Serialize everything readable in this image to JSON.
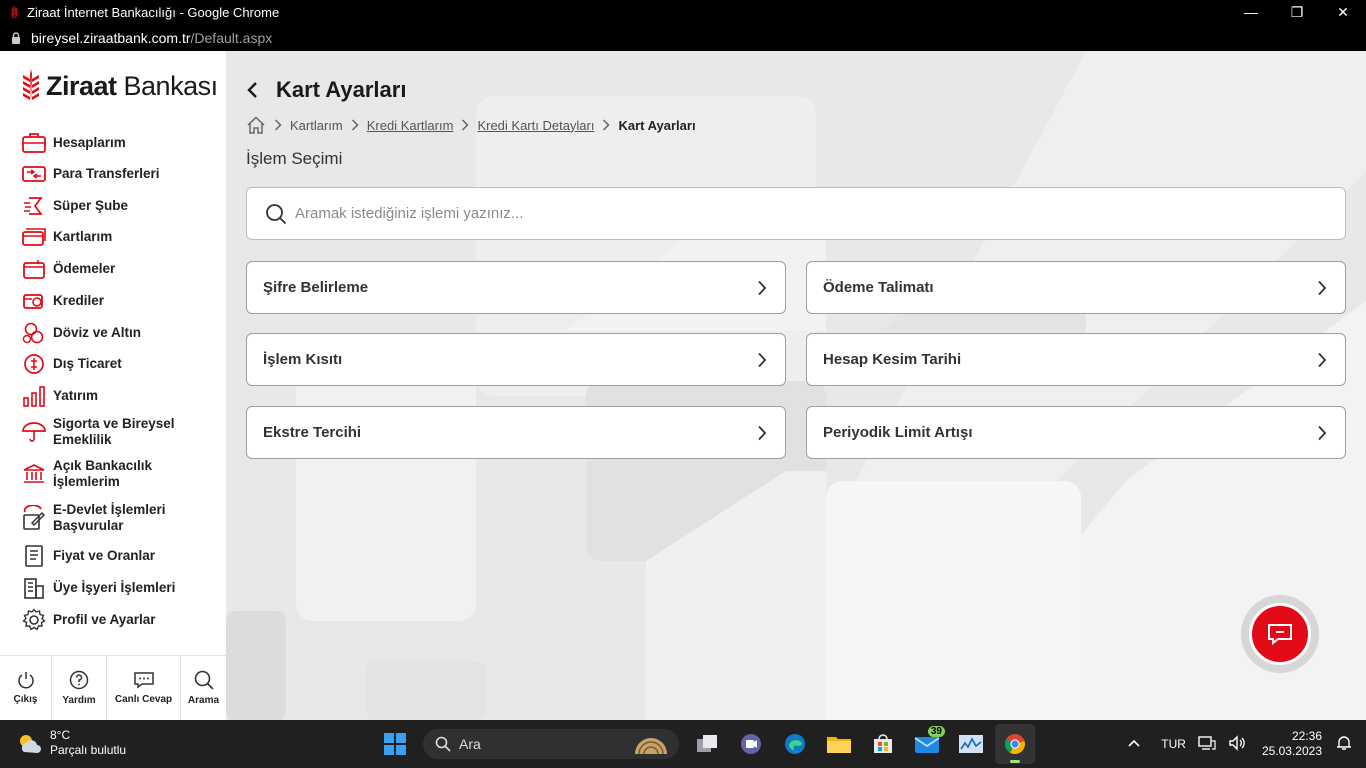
{
  "browser": {
    "window_title": "Ziraat İnternet Bankacılığı - Google Chrome",
    "url_host": "bireysel.ziraatbank.com.tr",
    "url_path": "/Default.aspx"
  },
  "brand": {
    "name_bold": "Ziraat",
    "name_light": " Bankası",
    "accent": "#e30a17"
  },
  "sidebar": {
    "items": [
      {
        "label": "Hesaplarım",
        "icon": "briefcase-icon"
      },
      {
        "label": "Para Transferleri",
        "icon": "transfer-icon"
      },
      {
        "label": "Süper Şube",
        "icon": "super-branch-icon"
      },
      {
        "label": "Kartlarım",
        "icon": "card-icon"
      },
      {
        "label": "Ödemeler",
        "icon": "payment-icon"
      },
      {
        "label": "Krediler",
        "icon": "credit-icon"
      },
      {
        "label": "Döviz ve Altın",
        "icon": "currency-icon"
      },
      {
        "label": "Dış Ticaret",
        "icon": "foreign-trade-icon"
      },
      {
        "label": "Yatırım",
        "icon": "investment-icon"
      },
      {
        "label": "Sigorta ve Bireysel Emeklilik",
        "icon": "umbrella-icon"
      },
      {
        "label": "Açık Bankacılık İşlemlerim",
        "icon": "bank-icon"
      },
      {
        "label": "E-Devlet İşlemleri Başvurular",
        "icon": "edevlet-icon"
      },
      {
        "label": "Fiyat ve Oranlar",
        "icon": "document-icon"
      },
      {
        "label": "Üye İşyeri İşlemleri",
        "icon": "building-icon"
      },
      {
        "label": "Profil ve Ayarlar",
        "icon": "gear-icon"
      }
    ],
    "bottom": [
      {
        "label": "Çıkış",
        "icon": "power-icon"
      },
      {
        "label": "Yardım",
        "icon": "help-icon"
      },
      {
        "label": "Canlı Cevap",
        "icon": "chat-icon"
      },
      {
        "label": "Arama",
        "icon": "search-icon"
      }
    ]
  },
  "main": {
    "title": "Kart Ayarları",
    "breadcrumb": {
      "items": [
        {
          "label": "Kartlarım",
          "link": false
        },
        {
          "label": "Kredi Kartlarım",
          "link": true
        },
        {
          "label": "Kredi Kartı Detayları",
          "link": true
        },
        {
          "label": "Kart Ayarları",
          "link": false,
          "current": true
        }
      ]
    },
    "section_title": "İşlem Seçimi",
    "search_placeholder": "Aramak istediğiniz işlemi yazınız...",
    "options": [
      {
        "label": "Şifre Belirleme"
      },
      {
        "label": "Ödeme Talimatı"
      },
      {
        "label": "İşlem Kısıtı"
      },
      {
        "label": "Hesap Kesim Tarihi"
      },
      {
        "label": "Ekstre Tercihi"
      },
      {
        "label": "Periyodik Limit Artışı"
      }
    ]
  },
  "taskbar": {
    "weather_temp": "8°C",
    "weather_desc": "Parçalı bulutlu",
    "search_label": "Ara",
    "mail_badge": "39",
    "language": "TUR",
    "time": "22:36",
    "date": "25.03.2023"
  }
}
